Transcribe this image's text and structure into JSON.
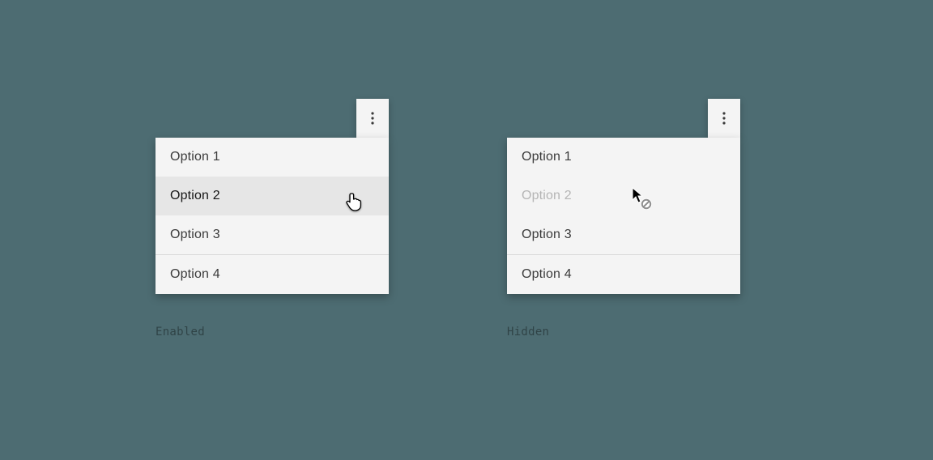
{
  "examples": {
    "enabled": {
      "caption": "Enabled",
      "items": [
        "Option 1",
        "Option 2",
        "Option 3",
        "Option 4"
      ],
      "hover_index": 1,
      "divider_before": 3
    },
    "hidden": {
      "caption": "Hidden",
      "items": [
        "Option 1",
        "Option 2",
        "Option 3",
        "Option 4"
      ],
      "disabled_index": 1,
      "divider_before": 3
    }
  },
  "icons": {
    "trigger": "overflow-vertical-icon",
    "cursors": {
      "pointer": "hand-cursor-icon",
      "not_allowed": "no-entry-cursor-icon"
    }
  }
}
